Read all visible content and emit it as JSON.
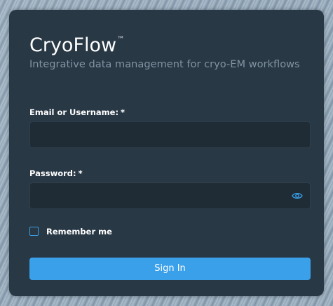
{
  "app": {
    "name": "CryoFlow",
    "trademark": "™",
    "tagline": "Integrative data management for cryo-EM workflows"
  },
  "form": {
    "username": {
      "label": "Email or Username:",
      "required_marker": "*",
      "value": "",
      "placeholder": ""
    },
    "password": {
      "label": "Password:",
      "required_marker": "*",
      "value": "",
      "placeholder": "",
      "toggle_icon": "eye-icon"
    },
    "remember": {
      "label": "Remember me",
      "checked": false
    },
    "submit_label": "Sign In"
  },
  "colors": {
    "card_background": "#283845",
    "accent": "#3aa0ea",
    "tagline": "#8293a1",
    "input_background": "#1f2c36"
  }
}
